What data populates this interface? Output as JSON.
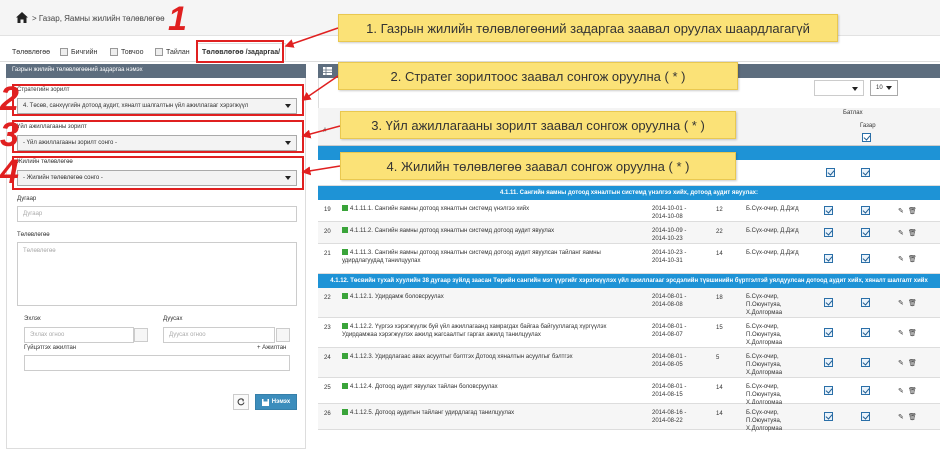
{
  "breadcrumb": {
    "text": "> Газар, Яамны жилийн төлөвлөгөө"
  },
  "tabs": [
    {
      "label": "Төлөвлөгөө"
    },
    {
      "label": "Бичгийн"
    },
    {
      "label": "Товчоо"
    },
    {
      "label": "Тайлан"
    },
    {
      "label": "Төлөвлөгөө /задаргаа/"
    }
  ],
  "form": {
    "header": "Газрын жилийн төлөвлөгөөний задаргаа нэмэх",
    "strategy_label": "Стратегийн зорилт",
    "strategy_value": "4. Төсөв, санхүүгийн дотоод аудит, хяналт шалгалтын үйл ажиллагааг хэрэгжүүл",
    "activity_label": "Үйл ажиллагааны зорилт",
    "activity_value": "- Үйл ажиллагааны зорилт сонго -",
    "plan_label": "Жилийн төлөвлөгөө",
    "plan_value": "- Жилийн төлөвлөгөө сонго -",
    "number_label": "Дугаар",
    "number_placeholder": "Дугаар",
    "plan_text_label": "Төлөвлөгөө",
    "plan_text_placeholder": "Төлөвлөгөө",
    "start_label": "Эхлэх",
    "start_placeholder": "Эхлах огноо",
    "end_label": "Дуусах",
    "end_placeholder": "Дуусах огноо",
    "executor_label": "Гүйцэтгэх ажилтан",
    "executor_add": "Ажилтан",
    "save_label": "Нэмэх"
  },
  "annotations": {
    "numbers": [
      "1",
      "2",
      "3",
      "4"
    ],
    "callouts": [
      "1. Газрын жилийн төлөвлөгөөний задаргаа заавал оруулах шаардлагагүй",
      "2. Стратег зорилтоос заавал сонгож оруулна ( * )",
      "3. Үйл ажиллагааны зорилт заавал сонгож оруулна ( * )",
      "4. Жилийн төлөвлөгөө заавал сонгож оруулна ( * )"
    ]
  },
  "grid": {
    "page_size": "10",
    "col_approve": "Батлах",
    "col_agency": "Газар",
    "col_hash": "#",
    "groups": [
      "4.1.11. Сангийн яамны дотоод хяналтын системд үнэлгээ хийх, дотоод аудит явуулах:",
      "4.1.12. Төсвийн тухай хуулийн 38 дугаар зүйлд заасан Төрийн сангийн мэт үүргийг хэрэгжүүлэх үйл ажиллагааг эрсдэлийн түвшинийн бүртгэлтэй уялдуулсан дотоод аудит хийх, хяналт шалгалт хийх"
    ],
    "rows": [
      {
        "no": "19",
        "title": "4.1.11.1. Сангийн яамны дотоод хяналтын системд үнэлгээ хийх",
        "dates": "2014-10-01 - 2014-10-08",
        "days": "12",
        "person": "Б.Сүх-очир, Д.Дэгд"
      },
      {
        "no": "20",
        "title": "4.1.11.2. Сангийн яамны дотоод хяналтын системд дотоод аудит явуулах",
        "dates": "2014-10-09 - 2014-10-23",
        "days": "22",
        "person": "Б.Сүх-очир, Д.Дэгд"
      },
      {
        "no": "21",
        "title": "4.1.11.3. Сангийн яамны дотоод хяналтын системд дотоод аудит явуулсан тайланг яамны удирдлагуудад танилцуулах",
        "dates": "2014-10-23 - 2014-10-31",
        "days": "14",
        "person": "Б.Сүх-очир, Д.Дэгд"
      },
      {
        "no": "22",
        "title": "4.1.12.1. Удирдамж боловсруулах",
        "dates": "2014-08-01 - 2014-08-08",
        "days": "18",
        "person": "Б.Сүх-очир, П.Оюунтуяа, Х.Долгормаа"
      },
      {
        "no": "23",
        "title": "4.1.12.2. Үүргээ хэрэгжүүлж буй үйл ажиллагаанд хамрагдах байгаа байгууллагад хүргүүлэх Удирдамжаа хэрэгжүүлэх ажилд жагсаалтыг гаргах ажилд танилцуулах",
        "dates": "2014-08-01 - 2014-08-07",
        "days": "15",
        "person": "Б.Сүх-очир, П.Оюунтуяа, Х.Долгормаа"
      },
      {
        "no": "24",
        "title": "4.1.12.3. Удирдлагаас авах асуултыг бэлтгэх Дотоод хяналтын асуулгыг бэлтгэх",
        "dates": "2014-08-01 - 2014-08-05",
        "days": "5",
        "person": "Б.Сүх-очир, П.Оюунтуяа, Х.Долгормаа"
      },
      {
        "no": "25",
        "title": "4.1.12.4. Дотоод аудит явуулах тайлан боловсруулах",
        "dates": "2014-08-01 - 2014-08-15",
        "days": "14",
        "person": "Б.Сүх-очир, П.Оюунтуяа, Х.Долгормаа"
      },
      {
        "no": "26",
        "title": "4.1.12.5. Дотоод аудитын тайланг удирдлагад танилцуулах",
        "dates": "2014-08-16 - 2014-08-22",
        "days": "14",
        "person": "Б.Сүх-очир, П.Оюунтуяа, Х.Долгормаа"
      }
    ]
  }
}
